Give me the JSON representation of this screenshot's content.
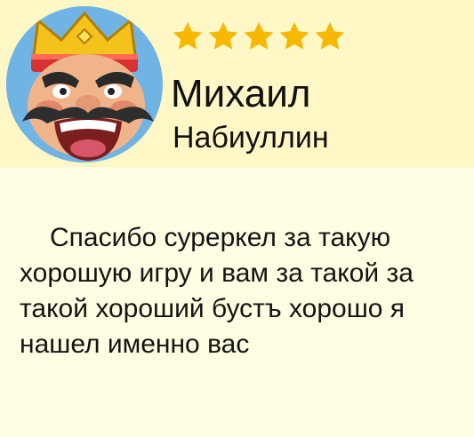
{
  "review_card": {
    "rating": 5,
    "star_color": "#f6b800",
    "header_color": "#fff7c6",
    "background_color": "#fffde2",
    "avatar_icon": "clash-royale-king-avatar",
    "first_name": "Михаил",
    "last_name": "Набиуллин",
    "text": "Спасибо суреркел за такую хорошую игру и вам за такой за такой хороший бустъ хорошо я нашел именно вас"
  }
}
